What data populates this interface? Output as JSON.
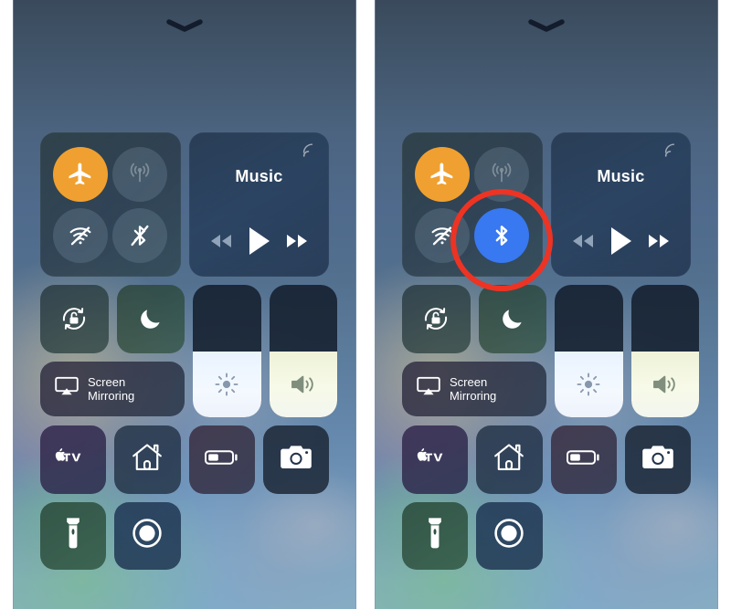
{
  "meta": {
    "screen_title": "iOS Control Center",
    "panels": [
      "before",
      "after"
    ],
    "accent_annotation_color": "#ed3323",
    "airplane_on_color": "#f0a030",
    "bluetooth_on_color": "#3878f0"
  },
  "panel_left": {
    "grabber_icon": "chevron-down-icon",
    "connectivity": {
      "airplane": {
        "label": "Airplane Mode",
        "icon": "airplane-icon",
        "state": "on"
      },
      "cellular": {
        "label": "Cellular Data",
        "icon": "cellular-antenna-icon",
        "state": "disabled"
      },
      "wifi": {
        "label": "Wi-Fi",
        "icon": "wifi-off-icon",
        "state": "off"
      },
      "bluetooth": {
        "label": "Bluetooth",
        "icon": "bluetooth-off-icon",
        "state": "off"
      }
    },
    "music": {
      "title": "Music",
      "airplay_icon": "airplay-audio-icon",
      "rewind_icon": "rewind-icon",
      "play_icon": "play-icon",
      "forward_icon": "fast-forward-icon"
    },
    "rotation_lock": {
      "label": "Rotation Lock",
      "icon": "rotation-lock-icon",
      "state": "off"
    },
    "do_not_disturb": {
      "label": "Do Not Disturb",
      "icon": "moon-icon",
      "state": "off"
    },
    "screen_mirroring": {
      "label": "Screen\nMirroring",
      "icon": "airplay-screen-icon"
    },
    "brightness": {
      "label": "Brightness",
      "icon": "sun-icon",
      "value_percent": 50
    },
    "volume": {
      "label": "Volume",
      "icon": "speaker-waves-icon",
      "value_percent": 50
    },
    "shortcuts": [
      {
        "label": "Apple TV Remote",
        "icon": "apple-tv-icon"
      },
      {
        "label": "Home",
        "icon": "home-icon"
      },
      {
        "label": "Low Power Mode",
        "icon": "battery-icon"
      },
      {
        "label": "Camera",
        "icon": "camera-icon"
      },
      {
        "label": "Flashlight",
        "icon": "flashlight-icon"
      },
      {
        "label": "Screen Recording",
        "icon": "record-icon"
      }
    ]
  },
  "panel_right": {
    "grabber_icon": "chevron-down-icon",
    "connectivity": {
      "airplane": {
        "label": "Airplane Mode",
        "icon": "airplane-icon",
        "state": "on"
      },
      "cellular": {
        "label": "Cellular Data",
        "icon": "cellular-antenna-icon",
        "state": "disabled"
      },
      "wifi": {
        "label": "Wi-Fi",
        "icon": "wifi-off-icon",
        "state": "off"
      },
      "bluetooth": {
        "label": "Bluetooth",
        "icon": "bluetooth-on-icon",
        "state": "on"
      }
    },
    "music": {
      "title": "Music",
      "airplay_icon": "airplay-audio-icon",
      "rewind_icon": "rewind-icon",
      "play_icon": "play-icon",
      "forward_icon": "fast-forward-icon"
    },
    "rotation_lock": {
      "label": "Rotation Lock",
      "icon": "rotation-lock-icon",
      "state": "off"
    },
    "do_not_disturb": {
      "label": "Do Not Disturb",
      "icon": "moon-icon",
      "state": "off"
    },
    "screen_mirroring": {
      "label": "Screen\nMirroring",
      "icon": "airplay-screen-icon"
    },
    "brightness": {
      "label": "Brightness",
      "icon": "sun-icon",
      "value_percent": 50
    },
    "volume": {
      "label": "Volume",
      "icon": "speaker-waves-icon",
      "value_percent": 50
    },
    "shortcuts": [
      {
        "label": "Apple TV Remote",
        "icon": "apple-tv-icon"
      },
      {
        "label": "Home",
        "icon": "home-icon"
      },
      {
        "label": "Low Power Mode",
        "icon": "battery-icon"
      },
      {
        "label": "Camera",
        "icon": "camera-icon"
      },
      {
        "label": "Flashlight",
        "icon": "flashlight-icon"
      },
      {
        "label": "Screen Recording",
        "icon": "record-icon"
      }
    ],
    "annotation": {
      "target": "bluetooth-toggle",
      "shape": "circle",
      "color": "#ed3323"
    }
  }
}
